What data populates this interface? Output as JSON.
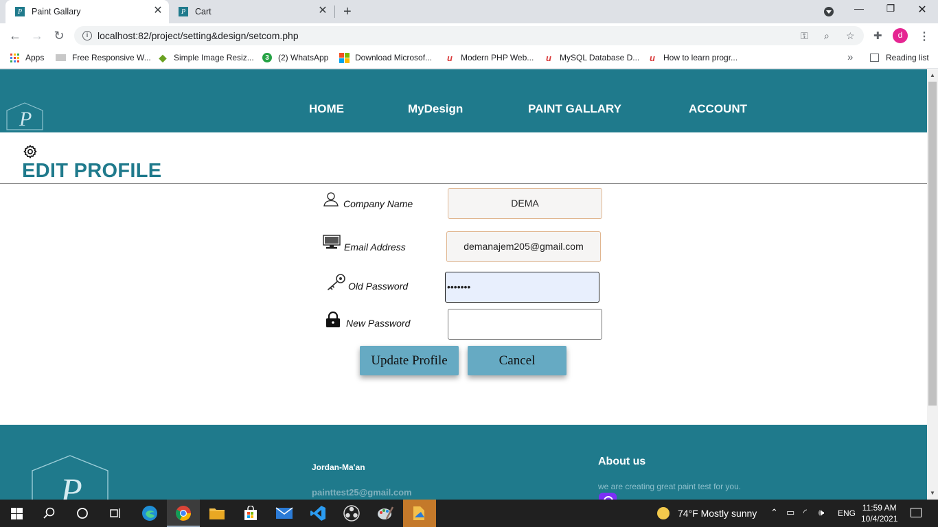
{
  "browser": {
    "tabs": [
      {
        "title": "Paint Gallary",
        "active": true
      },
      {
        "title": "Cart",
        "active": false
      }
    ],
    "url": "localhost:82/project/setting&design/setcom.php",
    "bookmarks": [
      "Apps",
      "Free Responsive W...",
      "Simple Image Resiz...",
      "(2) WhatsApp",
      "Download Microsof...",
      "Modern PHP Web...",
      "MySQL Database D...",
      "How to learn progr..."
    ],
    "whatsapp_badge": "3",
    "more_bookmarks": "»",
    "reading_list": "Reading list",
    "profile_initial": "d"
  },
  "nav": {
    "home": "HOME",
    "mydesign": "MyDesign",
    "gallery": "PAINT GALLARY",
    "account": "ACCOUNT"
  },
  "page": {
    "title": "EDIT PROFILE"
  },
  "form": {
    "company_label": "Company Name",
    "company_value": "DEMA",
    "email_label": "Email Address",
    "email_value": "demanajem205@gmail.com",
    "old_password_label": "Old Password",
    "old_password_value": "•••••••",
    "new_password_label": "New Password",
    "new_password_value": "",
    "update_button": "Update Profile",
    "cancel_button": "Cancel"
  },
  "footer": {
    "location": "Jordan-Ma'an",
    "email": "painttest25@gmail.com",
    "about_title": "About us",
    "about_text": "we are creating great paint test for you."
  },
  "taskbar": {
    "weather": "74°F  Mostly sunny",
    "language": "ENG",
    "time": "11:59 AM",
    "date": "10/4/2021"
  },
  "colors": {
    "brand": "#1f7a8c",
    "button": "#66aac3",
    "input_border": "#e0b58f",
    "focused_input_bg": "#e8effd"
  }
}
